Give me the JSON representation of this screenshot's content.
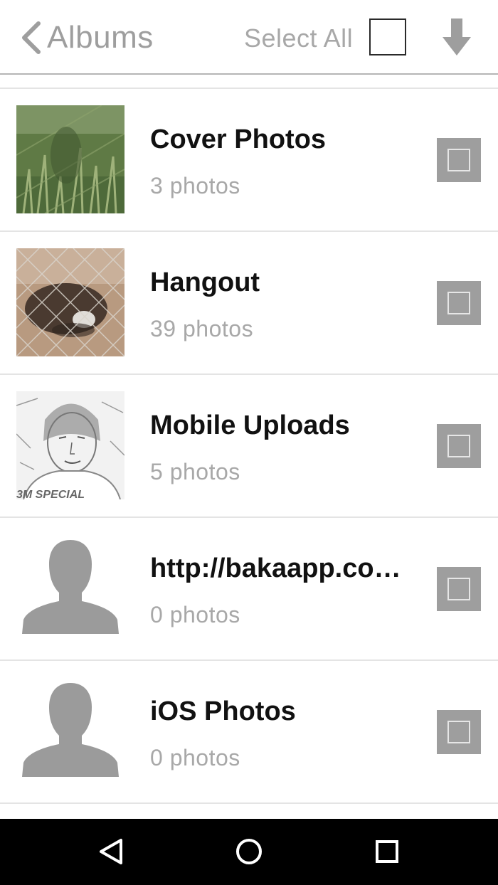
{
  "header": {
    "back_label": "Albums",
    "select_all_label": "Select All",
    "select_all_checked": false
  },
  "albums": [
    {
      "name": "Cover Photos",
      "count": "3 photos",
      "thumbnail": "grass-photo",
      "checked": false
    },
    {
      "name": "Hangout",
      "count": "39 photos",
      "thumbnail": "animal-fence-photo",
      "checked": false
    },
    {
      "name": "Mobile Uploads",
      "count": "5 photos",
      "thumbnail": "sketch-portrait-photo",
      "caption": "3M SPECIAL",
      "checked": false
    },
    {
      "name": "http://bakaapp.co…",
      "count": "0 photos",
      "thumbnail": "person-placeholder-icon",
      "checked": false
    },
    {
      "name": "iOS Photos",
      "count": "0 photos",
      "thumbnail": "person-placeholder-icon",
      "checked": false
    }
  ],
  "navbar": {
    "icons": [
      "back-triangle-icon",
      "home-circle-icon",
      "recents-square-icon"
    ]
  },
  "colors": {
    "accent_gray": "#9e9e9e",
    "text_dark": "#111111",
    "text_muted": "#a8a8a8",
    "navbar_bg": "#000000"
  }
}
